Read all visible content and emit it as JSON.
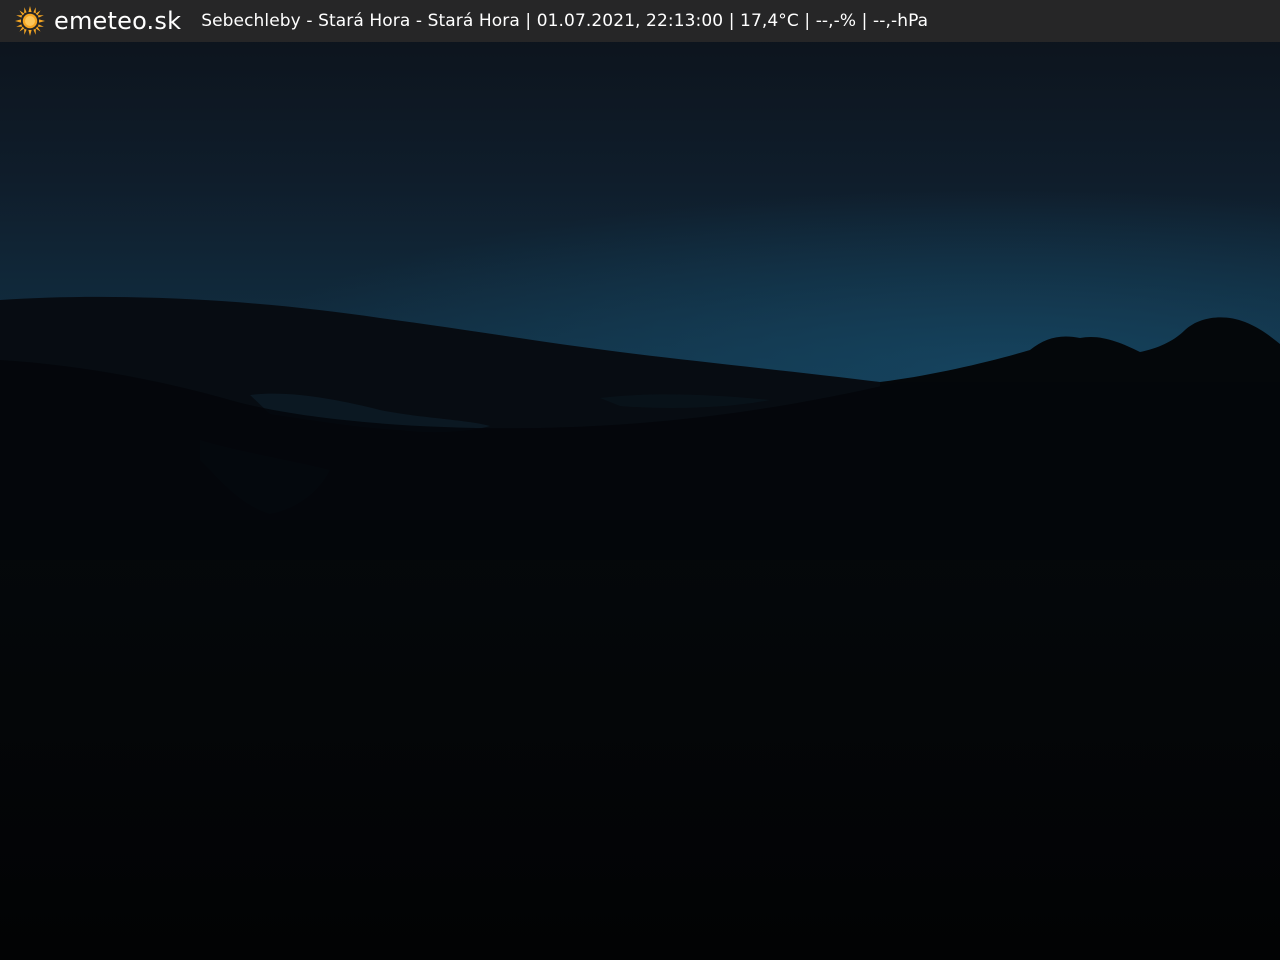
{
  "header": {
    "logo_icon": "sun-icon",
    "brand": "emeteo.sk",
    "caption": "Sebechleby - Stará Hora - Stará Hora | 01.07.2021, 22:13:00 | 17,4°C | --,-% | --,-hPa",
    "background": "#282828",
    "text_color": "#ffffff",
    "logo_color": "#f5a623"
  },
  "scene": {
    "sky_top": "#0b131e",
    "sky_horizon": "#123a52",
    "ground": "#030507"
  }
}
